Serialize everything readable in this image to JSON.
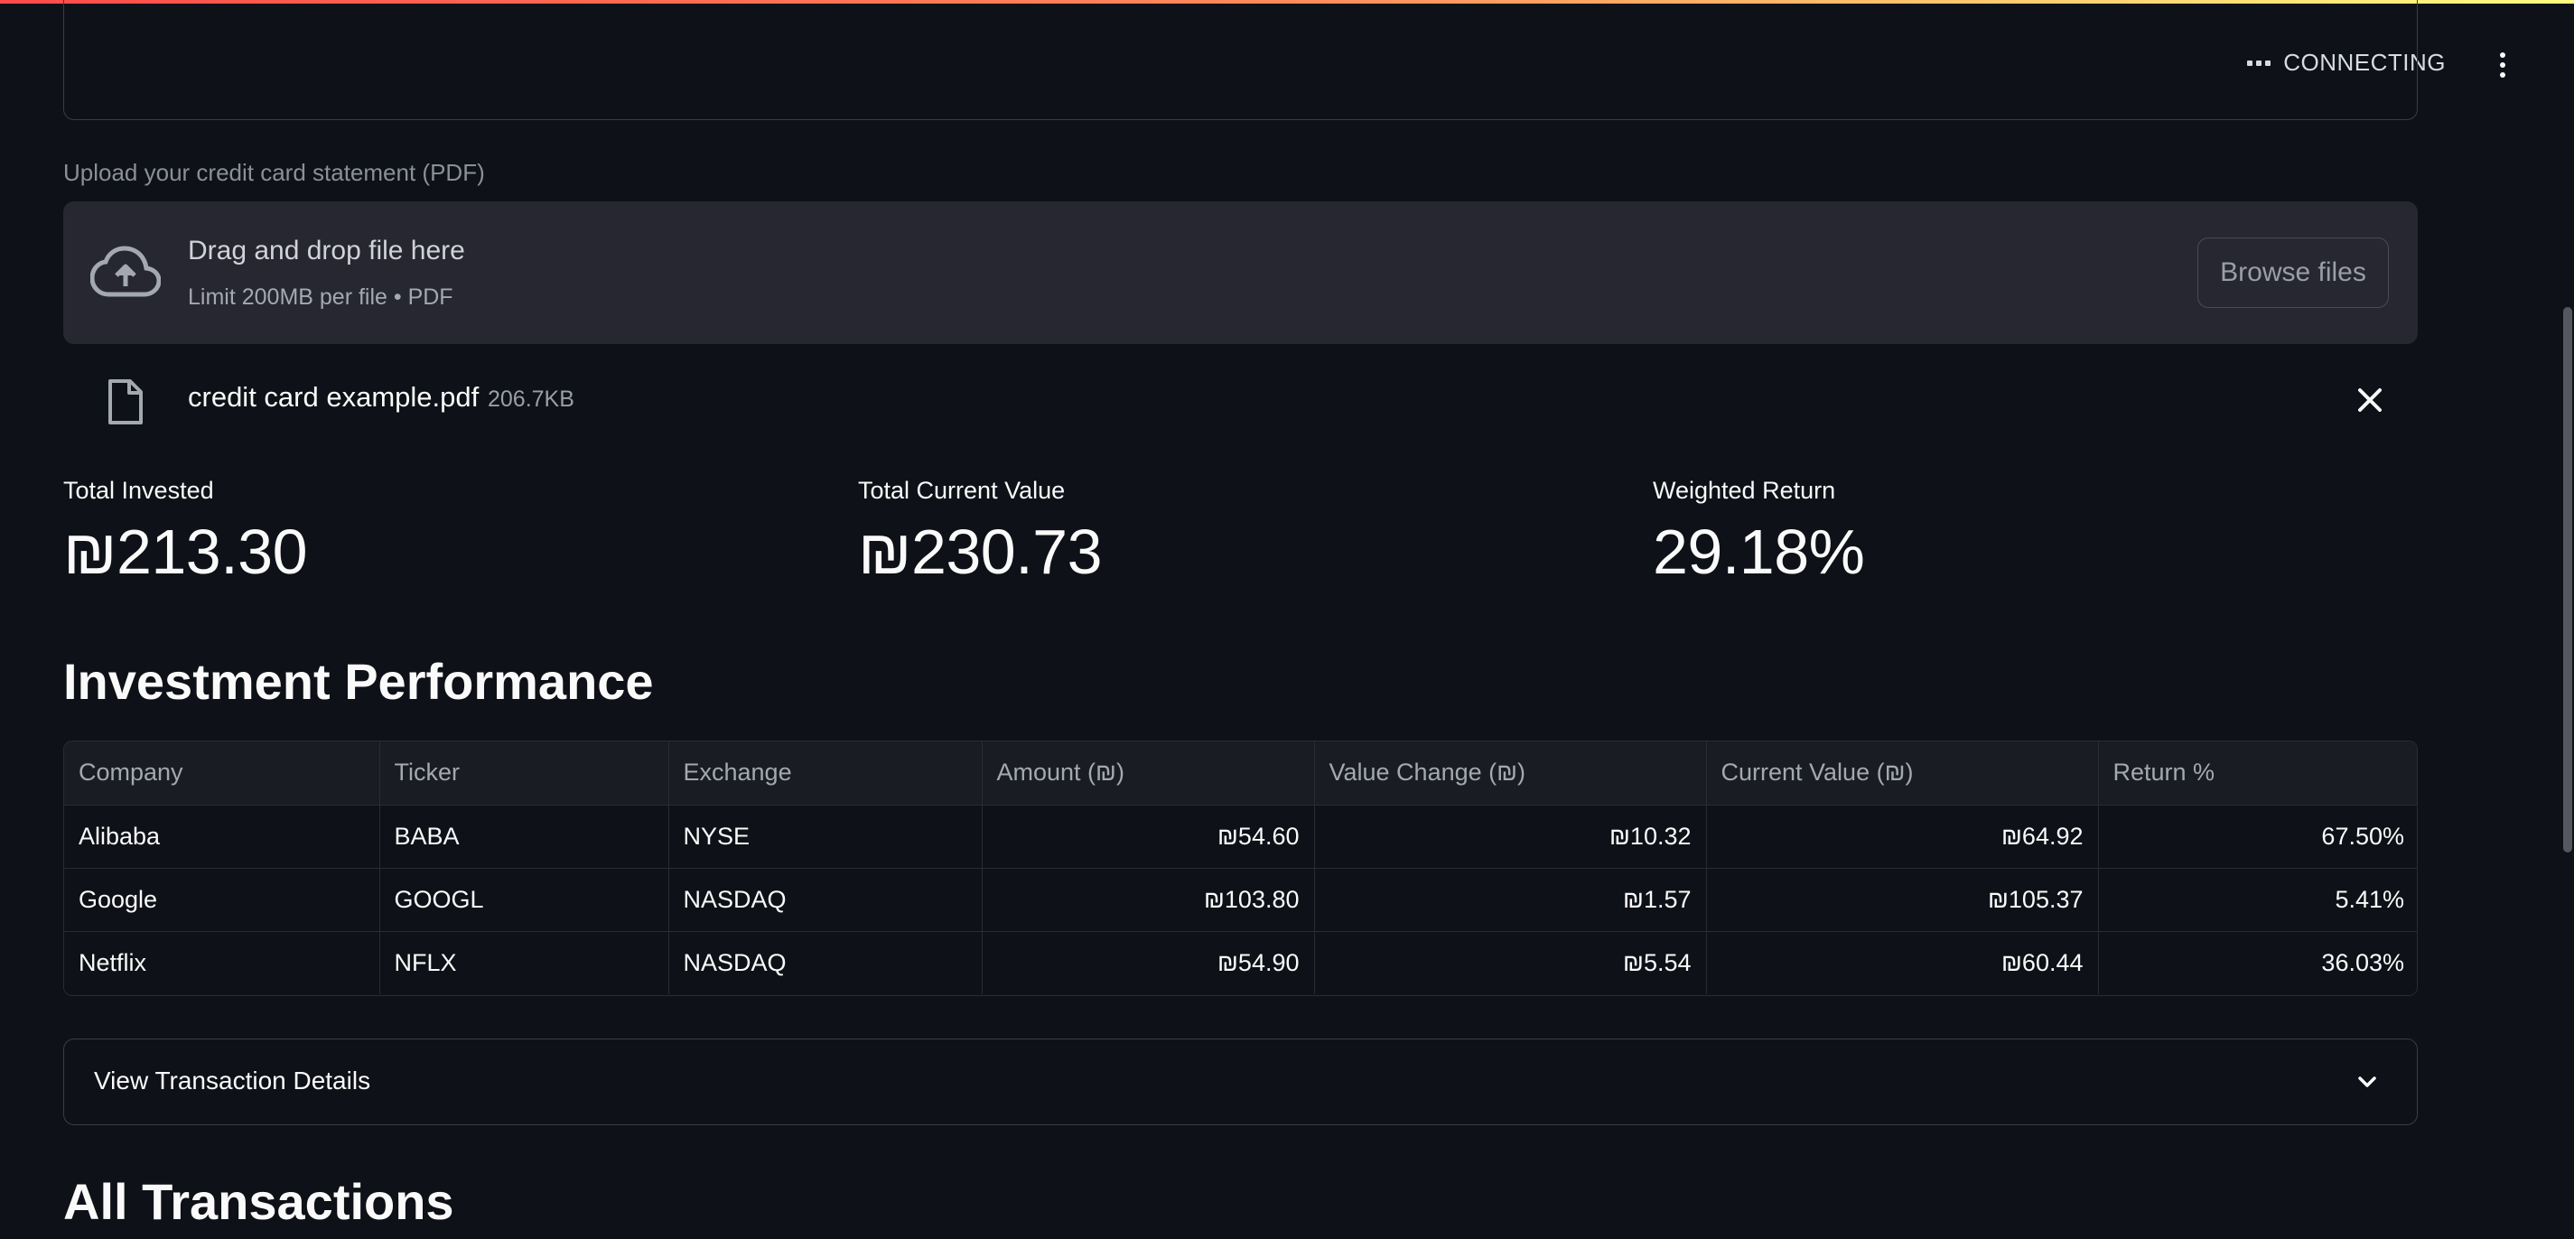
{
  "header": {
    "status_text": "CONNECTING"
  },
  "uploader": {
    "label": "Upload your credit card statement (PDF)",
    "drop_title": "Drag and drop file here",
    "drop_subtitle": "Limit 200MB per file • PDF",
    "browse_label": "Browse files"
  },
  "file": {
    "name": "credit card example.pdf",
    "size": "206.7KB"
  },
  "metrics": [
    {
      "label": "Total Invested",
      "value": "₪213.30"
    },
    {
      "label": "Total Current Value",
      "value": "₪230.73"
    },
    {
      "label": "Weighted Return",
      "value": "29.18%"
    }
  ],
  "performance": {
    "title": "Investment Performance",
    "columns": [
      "Company",
      "Ticker",
      "Exchange",
      "Amount (₪)",
      "Value Change (₪)",
      "Current Value (₪)",
      "Return %"
    ],
    "rows": [
      [
        "Alibaba",
        "BABA",
        "NYSE",
        "₪54.60",
        "₪10.32",
        "₪64.92",
        "67.50%"
      ],
      [
        "Google",
        "GOOGL",
        "NASDAQ",
        "₪103.80",
        "₪1.57",
        "₪105.37",
        "5.41%"
      ],
      [
        "Netflix",
        "NFLX",
        "NASDAQ",
        "₪54.90",
        "₪5.54",
        "₪60.44",
        "36.03%"
      ]
    ]
  },
  "expander": {
    "label": "View Transaction Details"
  },
  "transactions": {
    "title": "All Transactions"
  },
  "icons": {
    "upload": "cloud-upload-icon",
    "file": "file-icon",
    "close": "close-icon",
    "chevron": "chevron-down-icon",
    "menu": "more-vertical-icon"
  }
}
